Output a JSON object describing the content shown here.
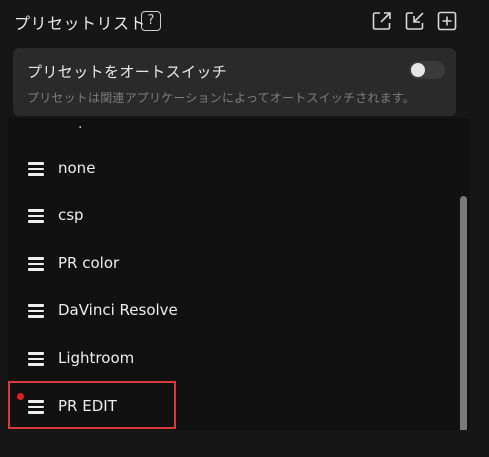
{
  "header": {
    "title": "プリセットリスト",
    "help_label": "?",
    "icons": [
      "export-icon",
      "import-icon",
      "add-icon"
    ]
  },
  "autoswitch": {
    "title": "プリセットをオートスイッチ",
    "description": "プリセットは関連アプリケーションによってオートスイッチされます。",
    "enabled": false
  },
  "presets": [
    {
      "label": "none"
    },
    {
      "label": "csp"
    },
    {
      "label": "PR color"
    },
    {
      "label": "DaVinci Resolve"
    },
    {
      "label": "Lightroom"
    },
    {
      "label": "PR EDIT",
      "active": true
    }
  ],
  "colors": {
    "background": "#161616",
    "panel": "#2a2a2a",
    "active_dot": "#e02020",
    "highlight": "#d9393b",
    "scrollbar": "#7a7a7a"
  }
}
